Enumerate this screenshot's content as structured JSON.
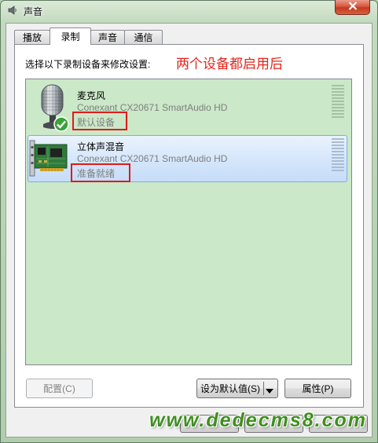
{
  "window": {
    "title": "声音",
    "app_icon": "speaker-icon",
    "close_icon": "close-icon"
  },
  "tabs": [
    {
      "label": "播放",
      "selected": false
    },
    {
      "label": "录制",
      "selected": true
    },
    {
      "label": "声音",
      "selected": false
    },
    {
      "label": "通信",
      "selected": false
    }
  ],
  "instruction": "选择以下录制设备来修改设置:",
  "annotation": {
    "text": "两个设备都启用后"
  },
  "devices": [
    {
      "name": "麦克风",
      "driver": "Conexant CX20671 SmartAudio HD",
      "status": "默认设备",
      "icon": "microphone-icon",
      "badge": "default-device-check-icon",
      "selected": false,
      "level": 0
    },
    {
      "name": "立体声混音",
      "driver": "Conexant CX20671 SmartAudio HD",
      "status": "准备就绪",
      "icon": "sound-card-icon",
      "selected": true,
      "level": 0
    }
  ],
  "buttons": {
    "configure": "配置(C)",
    "set_default": "设为默认值(S)",
    "properties": "属性(P)"
  },
  "watermark": "www.dedecms8.com",
  "colors": {
    "list_background": "#cbe8c8",
    "selection": "#d6e7fb",
    "annotation_red": "#e3261c",
    "highlight_box": "#e01a1a",
    "watermark_green": "#3f8f1f"
  }
}
